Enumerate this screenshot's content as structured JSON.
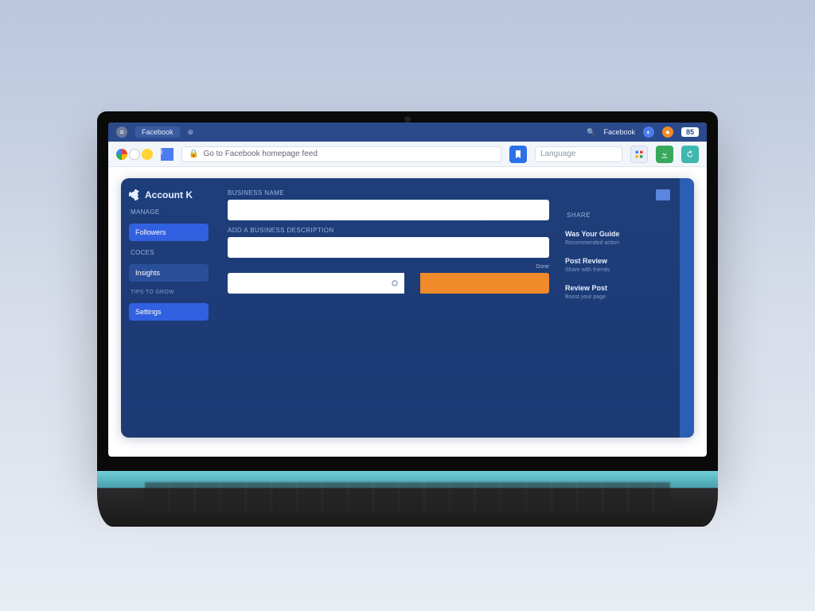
{
  "chrome": {
    "tab_label": "Facebook",
    "right_label": "Facebook",
    "battery_label": "85"
  },
  "toolbar": {
    "address_text": "Go to Facebook homepage feed",
    "search_placeholder": "Language"
  },
  "panel": {
    "title": "Account K",
    "sidebar": {
      "section1": "MANAGE",
      "items": [
        {
          "label": "Followers"
        },
        {
          "label": "Insights"
        },
        {
          "label": "Settings"
        }
      ],
      "section2": "COCES",
      "footer_tiny": "TIPS TO GROW"
    },
    "form": {
      "fields": [
        {
          "label": "BUSINESS NAME"
        },
        {
          "label": "ADD A BUSINESS DESCRIPTION"
        }
      ],
      "progress_hint": "Done"
    },
    "right": {
      "section": "SHARE",
      "items": [
        {
          "title": "Was Your Guide",
          "sub": "Recommended action"
        },
        {
          "title": "Post Review",
          "sub": "Share with friends"
        },
        {
          "title": "Review Post",
          "sub": "Boost your page"
        }
      ]
    }
  }
}
